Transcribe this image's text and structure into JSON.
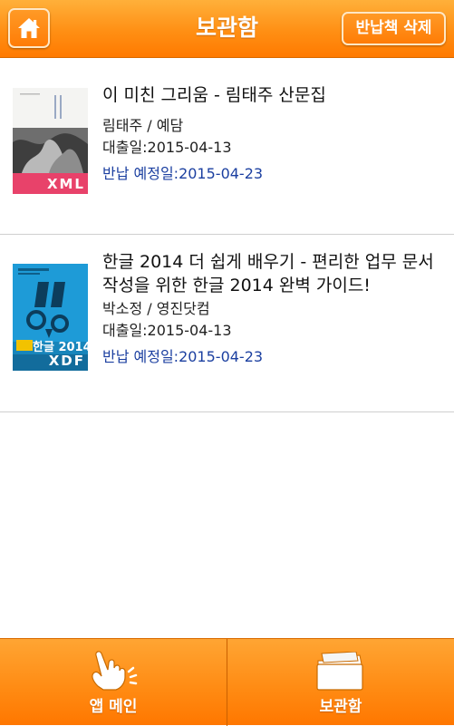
{
  "header": {
    "title": "보관함",
    "home_icon": "home-icon",
    "delete_label": "반납책 삭제"
  },
  "books": [
    {
      "title": "이 미친 그리움 - 림태주 산문집",
      "author_publisher": "림태주 / 예담",
      "loan_date": "대출일:2015-04-13",
      "due_date": "반납 예정일:2015-04-23",
      "cover_badge": "XML",
      "cover_accent": "#e8426a"
    },
    {
      "title": "한글 2014 더 쉽게 배우기 - 편리한 업무 문서 작성을 위한 한글 2014 완벽 가이드!",
      "author_publisher": "박소정 / 영진닷컴",
      "loan_date": "대출일:2015-04-13",
      "due_date": "반납 예정일:2015-04-23",
      "cover_badge": "XDF",
      "cover_text": "한글 2014",
      "cover_accent": "#1e9bd7"
    }
  ],
  "tabs": [
    {
      "label": "앱 메인",
      "icon": "hand-pointer-icon"
    },
    {
      "label": "보관함",
      "icon": "folder-icon"
    }
  ],
  "colors": {
    "accent": "#ff8a12",
    "due_text": "#1b3fa0"
  }
}
